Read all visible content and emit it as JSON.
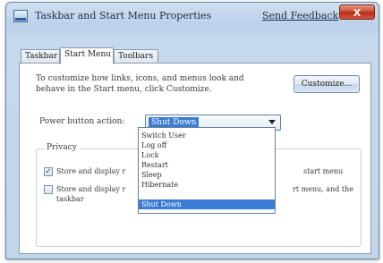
{
  "window": {
    "title": "Taskbar and Start Menu Properties",
    "feedback_link": "Send Feedback",
    "close_label": "X"
  },
  "tabs": [
    {
      "label": "Taskbar",
      "active": false
    },
    {
      "label": "Start Menu",
      "active": true
    },
    {
      "label": "Toolbars",
      "active": false
    }
  ],
  "start_menu": {
    "intro_line1": "To customize how links, icons, and menus look and",
    "intro_line2": "behave in the Start menu, click Customize.",
    "customize_button": "Customize...",
    "power_button_label": "Power button action:",
    "power_button_value": "Shut Down",
    "power_button_options": [
      "Switch User",
      "Log off",
      "Lock",
      "Restart",
      "Sleep",
      "Hibernate",
      "Shut Down"
    ],
    "power_button_selected_index": 6
  },
  "privacy": {
    "legend": "Privacy",
    "option1": {
      "text_left": "Store and display r",
      "text_right": "start menu",
      "checked": true
    },
    "option2": {
      "text_left": "Store and display r",
      "text_right": "rt menu, and the",
      "text_line2": "taskbar",
      "checked": false
    }
  },
  "colors": {
    "selection": "#3b7bd4",
    "title_bar": "#c2d6ea",
    "close_button": "#c9442c"
  }
}
